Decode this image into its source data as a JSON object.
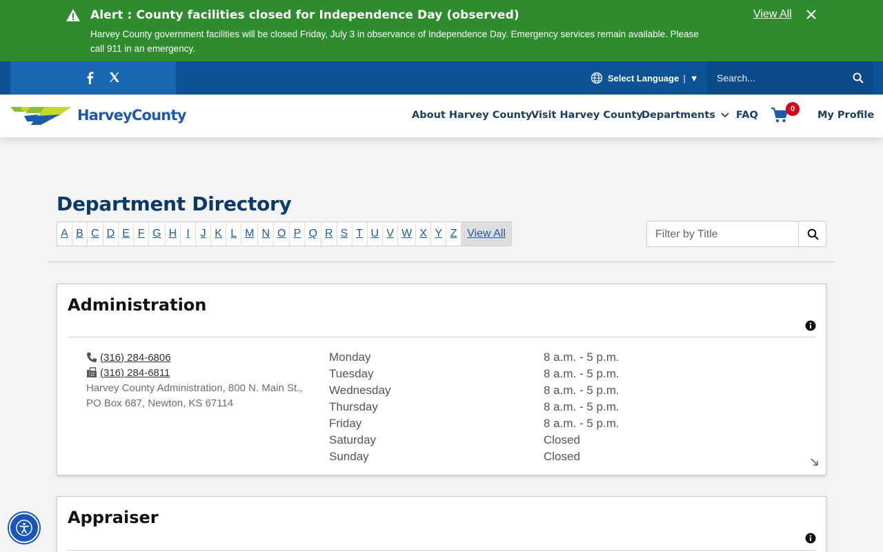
{
  "alert": {
    "title": "Alert : County facilities closed for Independence Day (observed)",
    "body": "Harvey County government facilities will be closed Friday, July 3 in observance of Independence Day. Emergency services remain available. Please call 911 in an emergency.",
    "view_all": "View All"
  },
  "utility": {
    "language_label": "Select Language",
    "language_sep": "|",
    "language_arrow": "▼",
    "search_placeholder": "Search..."
  },
  "brand": {
    "name": "HarveyCounty"
  },
  "nav": {
    "items": [
      "About Harvey County",
      "Visit Harvey County",
      "Departments",
      "FAQ",
      "My Profile"
    ],
    "cart_count": "0"
  },
  "directory": {
    "title": "Department Directory",
    "letters": [
      "A",
      "B",
      "C",
      "D",
      "E",
      "F",
      "G",
      "H",
      "I",
      "J",
      "K",
      "L",
      "M",
      "N",
      "O",
      "P",
      "Q",
      "R",
      "S",
      "T",
      "U",
      "V",
      "W",
      "X",
      "Y",
      "Z"
    ],
    "view_all": "View All",
    "filter_placeholder": "Filter by Title"
  },
  "departments": [
    {
      "name": "Administration",
      "phone": "(316) 284-6806",
      "fax": "(316) 284-6811",
      "address": "Harvey County Administration, 800 N. Main St., PO Box 687, Newton, KS 67114",
      "hours": [
        {
          "day": "Monday",
          "time": "8 a.m. - 5 p.m."
        },
        {
          "day": "Tuesday",
          "time": "8 a.m. - 5 p.m."
        },
        {
          "day": "Wednesday",
          "time": "8 a.m. - 5 p.m."
        },
        {
          "day": "Thursday",
          "time": "8 a.m. - 5 p.m."
        },
        {
          "day": "Friday",
          "time": "8 a.m. - 5 p.m."
        },
        {
          "day": "Saturday",
          "time": "Closed"
        },
        {
          "day": "Sunday",
          "time": "Closed"
        }
      ]
    },
    {
      "name": "Appraiser"
    }
  ],
  "colors": {
    "alert_bg": "#2e8b2e",
    "utility_bg": "#0b5394",
    "heading": "#0b3a6a",
    "link": "#1d5aa8",
    "badge": "#d9001b"
  }
}
